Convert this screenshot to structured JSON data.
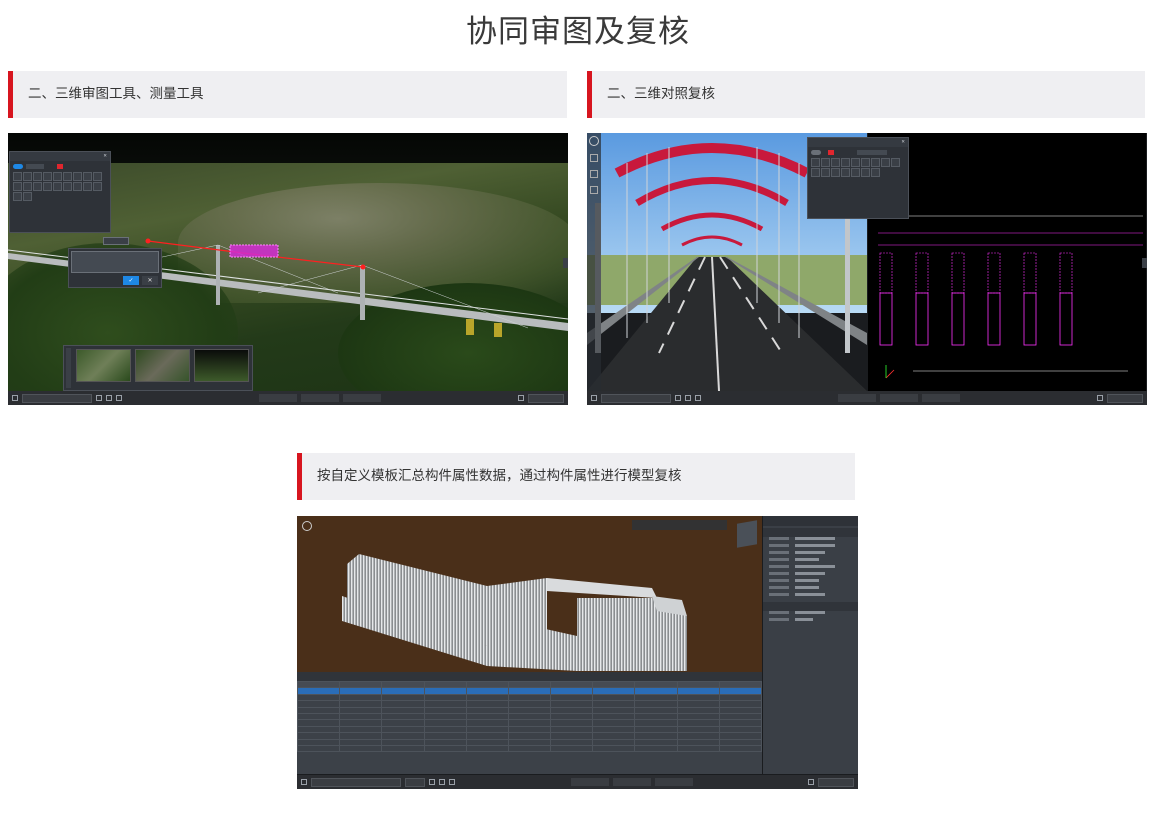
{
  "page": {
    "title": "协同审图及复核"
  },
  "sections": {
    "tools": {
      "caption": "二、三维审图工具、测量工具"
    },
    "compare": {
      "caption": "二、三维对照复核"
    },
    "attributes": {
      "caption": "按自定义模板汇总构件属性数据，通过构件属性进行模型复核"
    }
  },
  "colors": {
    "accent_red": "#d7151f",
    "caption_bg": "#efeff2",
    "bridge_arch": "#c8193c",
    "cad_magenta": "#ff33ff",
    "selection_blue": "#2a6db8"
  },
  "icons": {
    "confirm": "✓",
    "close": "✕",
    "fullscreen": "⛶"
  }
}
